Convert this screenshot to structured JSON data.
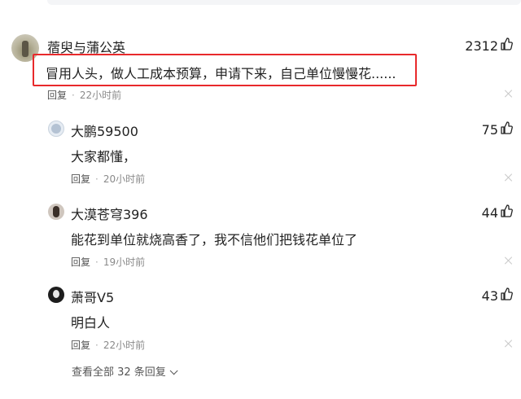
{
  "main_comment": {
    "author": "蓿臾与蒲公英",
    "text": "冒用人头，做人工成本预算，申请下来，自己单位慢慢花......",
    "reply_label": "回复",
    "time": "22小时前",
    "likes": "2312"
  },
  "replies": [
    {
      "author": "大鹏59500",
      "text": "大家都懂，",
      "reply_label": "回复",
      "time": "20小时前",
      "likes": "75"
    },
    {
      "author": "大漠苍穹396",
      "text": "能花到单位就烧高香了，我不信他们把钱花单位了",
      "reply_label": "回复",
      "time": "19小时前",
      "likes": "44"
    },
    {
      "author": "萧哥V5",
      "text": "明白人",
      "reply_label": "回复",
      "time": "22小时前",
      "likes": "43"
    }
  ],
  "view_all": "查看全部 32 条回复",
  "icons": {
    "like": "thumbs-up-icon",
    "close": "close-icon",
    "expand": "chevron-down-icon"
  },
  "colors": {
    "highlight_border": "#e8292b",
    "meta_text": "#8a8a8a"
  }
}
